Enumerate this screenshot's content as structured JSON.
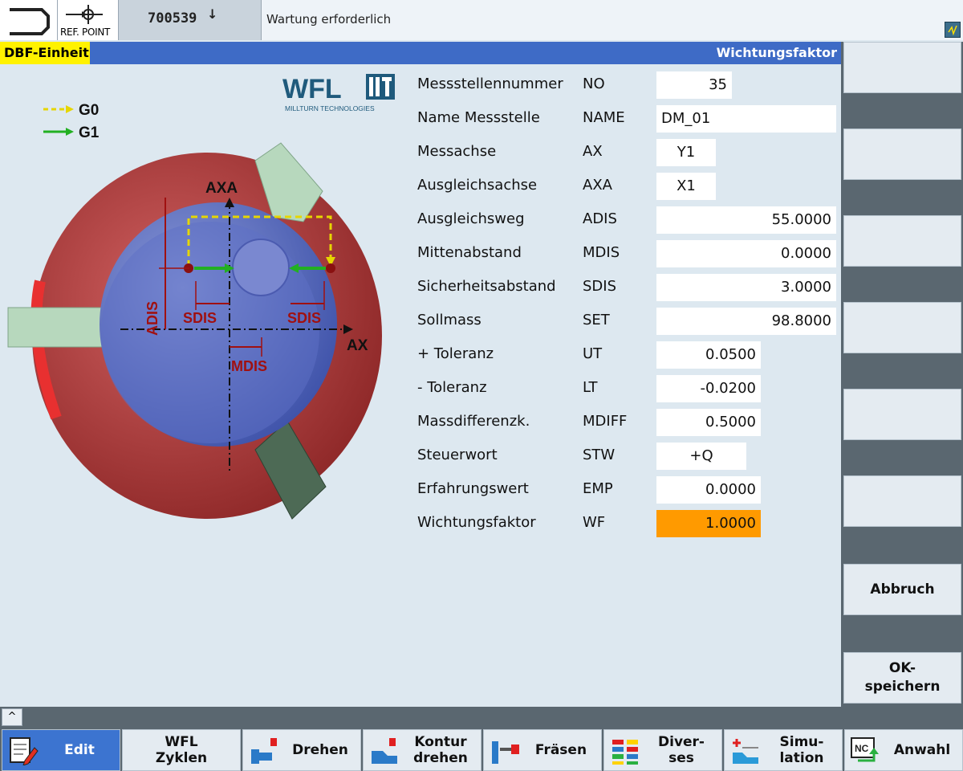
{
  "topbar": {
    "mode_icon": "jog-mode-icon",
    "ref_point_label": "REF. POINT",
    "program_number": "700539",
    "program_arrow": "↓",
    "alarm_message": "Wartung erforderlich",
    "hmi_icon": "hmi-status-icon"
  },
  "titlebar": {
    "left": "DBF-Einheit",
    "right": "Wichtungsfaktor"
  },
  "graphic": {
    "logo_text": "WFL",
    "logo_subtitle": "MILLTURN TECHNOLOGIES",
    "legend": [
      {
        "label": "G0",
        "color": "#e6d600"
      },
      {
        "label": "G1",
        "color": "#22b022"
      }
    ],
    "axis_labels": {
      "axa": "AXA",
      "ax": "AX"
    },
    "dimension_labels": {
      "adis": "ADIS",
      "sdis": "SDIS",
      "mdis": "MDIS"
    },
    "colors": {
      "chuck": "#b03838",
      "part": "#5a6fc4",
      "dimension": "#a01010",
      "jaws": "#bfe0c4"
    }
  },
  "params": [
    {
      "label": "Messstellennummer",
      "short": "NO",
      "value": "35"
    },
    {
      "label": "Name Messstelle",
      "short": "NAME",
      "value": "DM_01"
    },
    {
      "label": "Messachse",
      "short": "AX",
      "value": "Y1"
    },
    {
      "label": "Ausgleichsachse",
      "short": "AXA",
      "value": "X1"
    },
    {
      "label": "Ausgleichsweg",
      "short": "ADIS",
      "value": "55.0000"
    },
    {
      "label": "Mittenabstand",
      "short": "MDIS",
      "value": "0.0000"
    },
    {
      "label": "Sicherheitsabstand",
      "short": "SDIS",
      "value": "3.0000"
    },
    {
      "label": "Sollmass",
      "short": "SET",
      "value": "98.8000"
    },
    {
      "label": "+ Toleranz",
      "short": "UT",
      "value": "0.0500"
    },
    {
      "label": "- Toleranz",
      "short": "LT",
      "value": "-0.0200"
    },
    {
      "label": "Massdifferenzk.",
      "short": "MDIFF",
      "value": "0.5000"
    },
    {
      "label": "Steuerwort",
      "short": "STW",
      "value": "+Q"
    },
    {
      "label": "Erfahrungswert",
      "short": "EMP",
      "value": "0.0000"
    },
    {
      "label": "Wichtungsfaktor",
      "short": "WF",
      "value": "1.0000"
    }
  ],
  "active_field_color": "#ff9a00",
  "vertical_softkeys": {
    "abbruch": "Abbruch",
    "ok_line1": "OK-",
    "ok_line2": "speichern"
  },
  "horizontal_softkeys": [
    {
      "line1": "Edit",
      "line2": "",
      "icon": "edit-icon"
    },
    {
      "line1": "WFL",
      "line2": "Zyklen",
      "icon": ""
    },
    {
      "line1": "Drehen",
      "line2": "",
      "icon": "turning-icon"
    },
    {
      "line1": "Kontur",
      "line2": "drehen",
      "icon": "contour-turning-icon"
    },
    {
      "line1": "Fräsen",
      "line2": "",
      "icon": "milling-icon"
    },
    {
      "line1": "Diver-",
      "line2": "ses",
      "icon": "misc-icon"
    },
    {
      "line1": "Simu-",
      "line2": "lation",
      "icon": "simulation-icon"
    },
    {
      "line1": "Anwahl",
      "line2": "",
      "icon": "nc-select-icon"
    }
  ],
  "recall_symbol": "^"
}
